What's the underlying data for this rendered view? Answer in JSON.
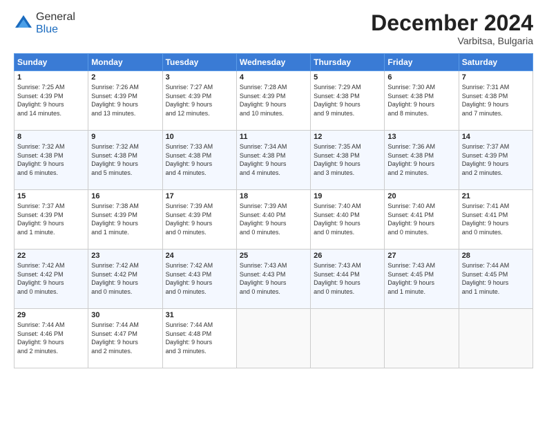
{
  "logo": {
    "general": "General",
    "blue": "Blue"
  },
  "header": {
    "month_year": "December 2024",
    "location": "Varbitsa, Bulgaria"
  },
  "days_of_week": [
    "Sunday",
    "Monday",
    "Tuesday",
    "Wednesday",
    "Thursday",
    "Friday",
    "Saturday"
  ],
  "weeks": [
    [
      {
        "day": "1",
        "lines": [
          "Sunrise: 7:25 AM",
          "Sunset: 4:39 PM",
          "Daylight: 9 hours",
          "and 14 minutes."
        ]
      },
      {
        "day": "2",
        "lines": [
          "Sunrise: 7:26 AM",
          "Sunset: 4:39 PM",
          "Daylight: 9 hours",
          "and 13 minutes."
        ]
      },
      {
        "day": "3",
        "lines": [
          "Sunrise: 7:27 AM",
          "Sunset: 4:39 PM",
          "Daylight: 9 hours",
          "and 12 minutes."
        ]
      },
      {
        "day": "4",
        "lines": [
          "Sunrise: 7:28 AM",
          "Sunset: 4:39 PM",
          "Daylight: 9 hours",
          "and 10 minutes."
        ]
      },
      {
        "day": "5",
        "lines": [
          "Sunrise: 7:29 AM",
          "Sunset: 4:38 PM",
          "Daylight: 9 hours",
          "and 9 minutes."
        ]
      },
      {
        "day": "6",
        "lines": [
          "Sunrise: 7:30 AM",
          "Sunset: 4:38 PM",
          "Daylight: 9 hours",
          "and 8 minutes."
        ]
      },
      {
        "day": "7",
        "lines": [
          "Sunrise: 7:31 AM",
          "Sunset: 4:38 PM",
          "Daylight: 9 hours",
          "and 7 minutes."
        ]
      }
    ],
    [
      {
        "day": "8",
        "lines": [
          "Sunrise: 7:32 AM",
          "Sunset: 4:38 PM",
          "Daylight: 9 hours",
          "and 6 minutes."
        ]
      },
      {
        "day": "9",
        "lines": [
          "Sunrise: 7:32 AM",
          "Sunset: 4:38 PM",
          "Daylight: 9 hours",
          "and 5 minutes."
        ]
      },
      {
        "day": "10",
        "lines": [
          "Sunrise: 7:33 AM",
          "Sunset: 4:38 PM",
          "Daylight: 9 hours",
          "and 4 minutes."
        ]
      },
      {
        "day": "11",
        "lines": [
          "Sunrise: 7:34 AM",
          "Sunset: 4:38 PM",
          "Daylight: 9 hours",
          "and 4 minutes."
        ]
      },
      {
        "day": "12",
        "lines": [
          "Sunrise: 7:35 AM",
          "Sunset: 4:38 PM",
          "Daylight: 9 hours",
          "and 3 minutes."
        ]
      },
      {
        "day": "13",
        "lines": [
          "Sunrise: 7:36 AM",
          "Sunset: 4:38 PM",
          "Daylight: 9 hours",
          "and 2 minutes."
        ]
      },
      {
        "day": "14",
        "lines": [
          "Sunrise: 7:37 AM",
          "Sunset: 4:39 PM",
          "Daylight: 9 hours",
          "and 2 minutes."
        ]
      }
    ],
    [
      {
        "day": "15",
        "lines": [
          "Sunrise: 7:37 AM",
          "Sunset: 4:39 PM",
          "Daylight: 9 hours",
          "and 1 minute."
        ]
      },
      {
        "day": "16",
        "lines": [
          "Sunrise: 7:38 AM",
          "Sunset: 4:39 PM",
          "Daylight: 9 hours",
          "and 1 minute."
        ]
      },
      {
        "day": "17",
        "lines": [
          "Sunrise: 7:39 AM",
          "Sunset: 4:39 PM",
          "Daylight: 9 hours",
          "and 0 minutes."
        ]
      },
      {
        "day": "18",
        "lines": [
          "Sunrise: 7:39 AM",
          "Sunset: 4:40 PM",
          "Daylight: 9 hours",
          "and 0 minutes."
        ]
      },
      {
        "day": "19",
        "lines": [
          "Sunrise: 7:40 AM",
          "Sunset: 4:40 PM",
          "Daylight: 9 hours",
          "and 0 minutes."
        ]
      },
      {
        "day": "20",
        "lines": [
          "Sunrise: 7:40 AM",
          "Sunset: 4:41 PM",
          "Daylight: 9 hours",
          "and 0 minutes."
        ]
      },
      {
        "day": "21",
        "lines": [
          "Sunrise: 7:41 AM",
          "Sunset: 4:41 PM",
          "Daylight: 9 hours",
          "and 0 minutes."
        ]
      }
    ],
    [
      {
        "day": "22",
        "lines": [
          "Sunrise: 7:42 AM",
          "Sunset: 4:42 PM",
          "Daylight: 9 hours",
          "and 0 minutes."
        ]
      },
      {
        "day": "23",
        "lines": [
          "Sunrise: 7:42 AM",
          "Sunset: 4:42 PM",
          "Daylight: 9 hours",
          "and 0 minutes."
        ]
      },
      {
        "day": "24",
        "lines": [
          "Sunrise: 7:42 AM",
          "Sunset: 4:43 PM",
          "Daylight: 9 hours",
          "and 0 minutes."
        ]
      },
      {
        "day": "25",
        "lines": [
          "Sunrise: 7:43 AM",
          "Sunset: 4:43 PM",
          "Daylight: 9 hours",
          "and 0 minutes."
        ]
      },
      {
        "day": "26",
        "lines": [
          "Sunrise: 7:43 AM",
          "Sunset: 4:44 PM",
          "Daylight: 9 hours",
          "and 0 minutes."
        ]
      },
      {
        "day": "27",
        "lines": [
          "Sunrise: 7:43 AM",
          "Sunset: 4:45 PM",
          "Daylight: 9 hours",
          "and 1 minute."
        ]
      },
      {
        "day": "28",
        "lines": [
          "Sunrise: 7:44 AM",
          "Sunset: 4:45 PM",
          "Daylight: 9 hours",
          "and 1 minute."
        ]
      }
    ],
    [
      {
        "day": "29",
        "lines": [
          "Sunrise: 7:44 AM",
          "Sunset: 4:46 PM",
          "Daylight: 9 hours",
          "and 2 minutes."
        ]
      },
      {
        "day": "30",
        "lines": [
          "Sunrise: 7:44 AM",
          "Sunset: 4:47 PM",
          "Daylight: 9 hours",
          "and 2 minutes."
        ]
      },
      {
        "day": "31",
        "lines": [
          "Sunrise: 7:44 AM",
          "Sunset: 4:48 PM",
          "Daylight: 9 hours",
          "and 3 minutes."
        ]
      },
      null,
      null,
      null,
      null
    ]
  ]
}
